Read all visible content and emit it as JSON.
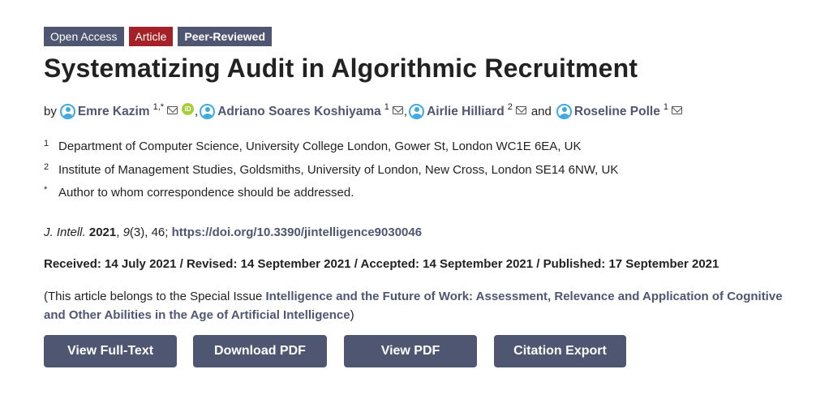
{
  "badges": {
    "open_access": "Open Access",
    "article": "Article",
    "peer_reviewed": "Peer-Reviewed"
  },
  "title": "Systematizing Audit in Algorithmic Recruitment",
  "authors": {
    "by": "by",
    "list": [
      {
        "name": "Emre Kazim",
        "sup": "1,*"
      },
      {
        "name": "Adriano Soares Koshiyama",
        "sup": "1"
      },
      {
        "name": "Airlie Hilliard",
        "sup": "2"
      },
      {
        "name": "Roseline Polle",
        "sup": "1"
      }
    ],
    "comma": ",",
    "and": "and",
    "orcid_label": "iD"
  },
  "affiliations": [
    {
      "num": "1",
      "text": "Department of Computer Science, University College London, Gower St, London WC1E 6EA, UK"
    },
    {
      "num": "2",
      "text": "Institute of Management Studies, Goldsmiths, University of London, New Cross, London SE14 6NW, UK"
    },
    {
      "num": "*",
      "text": "Author to whom correspondence should be addressed."
    }
  ],
  "citation": {
    "journal": "J. Intell.",
    "year": "2021",
    "volume": "9",
    "issue_pages": "(3), 46;",
    "doi": "https://doi.org/10.3390/jintelligence9030046"
  },
  "dates": "Received: 14 July 2021 / Revised: 14 September 2021 / Accepted: 14 September 2021 / Published: 17 September 2021",
  "special_issue": {
    "prefix": "(This article belongs to the Special Issue ",
    "link": "Intelligence and the Future of Work: Assessment, Relevance and Application of Cognitive and Other Abilities in the Age of Artificial Intelligence",
    "suffix": ")"
  },
  "buttons": {
    "full_text": "View Full-Text",
    "download_pdf": "Download PDF",
    "view_pdf": "View PDF",
    "citation_export": "Citation Export"
  },
  "icons": {
    "author": "person-icon",
    "email": "mail-icon",
    "orcid": "orcid-icon"
  },
  "colors": {
    "accent": "#4f5671",
    "article_badge": "#a52127",
    "author_icon": "#3fa9e0",
    "orcid": "#a6ce39"
  }
}
